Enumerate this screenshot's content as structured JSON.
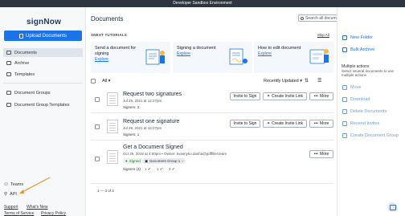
{
  "topbar": {
    "title": "Developer Sandbox Environment"
  },
  "sidebar": {
    "logo": "signNow",
    "upload_label": "Upload Documents",
    "items": [
      {
        "label": "Documents"
      },
      {
        "label": "Archive"
      },
      {
        "label": "Templates"
      },
      {
        "label": "Document Groups"
      },
      {
        "label": "Document Group Templates"
      }
    ],
    "bottom_items": [
      {
        "label": "Teams"
      },
      {
        "label": "API"
      }
    ],
    "links": {
      "support": "Support",
      "whats_new": "What's New",
      "terms": "Terms of Service",
      "privacy": "Privacy Policy"
    }
  },
  "header": {
    "title": "Documents",
    "search_placeholder": "Search all documents",
    "search_dd": "▾",
    "avatar_dd": "▾"
  },
  "tutorials": {
    "title": "SNEXT TUTORIALS",
    "skip": "Skip All",
    "cards": [
      {
        "text": "Send a document for signing",
        "link": "Explore"
      },
      {
        "text": "Signing a document",
        "link": "Explore"
      },
      {
        "text": "How to edit document",
        "link": "Explore"
      }
    ]
  },
  "list": {
    "filter": "All",
    "sort": "Recently Updated",
    "pager": "1 — 3 of 3"
  },
  "documents": [
    {
      "title": "Request two signatures",
      "meta": "Jul 29, 2021 at 12:27pm",
      "signers": "Signers: 2",
      "invite": "Invite to Sign",
      "link": "Create Invite Link",
      "more": "More"
    },
    {
      "title": "Request one signature",
      "meta": "Jul 29, 2021 at 12:27pm",
      "signers": "Signers: 1",
      "invite": "Invite to Sign",
      "link": "Create Invite Link",
      "more": "More"
    },
    {
      "title": "Get a Document Signed",
      "meta": "Oct 29, 2019 at 4:00pm  •  Owner: kvasnyko.dasha@pdffiller.team",
      "status": "Signed",
      "group": "Document Group 1",
      "signers": "Signers (3)",
      "counts": [
        "1",
        "1",
        "2"
      ],
      "more": "More"
    }
  ],
  "right_panel": {
    "new_folder": "New Folder",
    "bulk_archive": "Bulk Archive",
    "multiple_title": "Multiple actions",
    "multiple_sub": "Select several documents to use multiple actions",
    "actions": [
      "Move",
      "Download",
      "Delete Documents",
      "Resend Invites",
      "Create Document Group"
    ]
  },
  "colors": {
    "accent": "#1a73e8",
    "topbar": "#2c3540",
    "annotation": "#f28c28",
    "signed": "#2e7d32"
  }
}
